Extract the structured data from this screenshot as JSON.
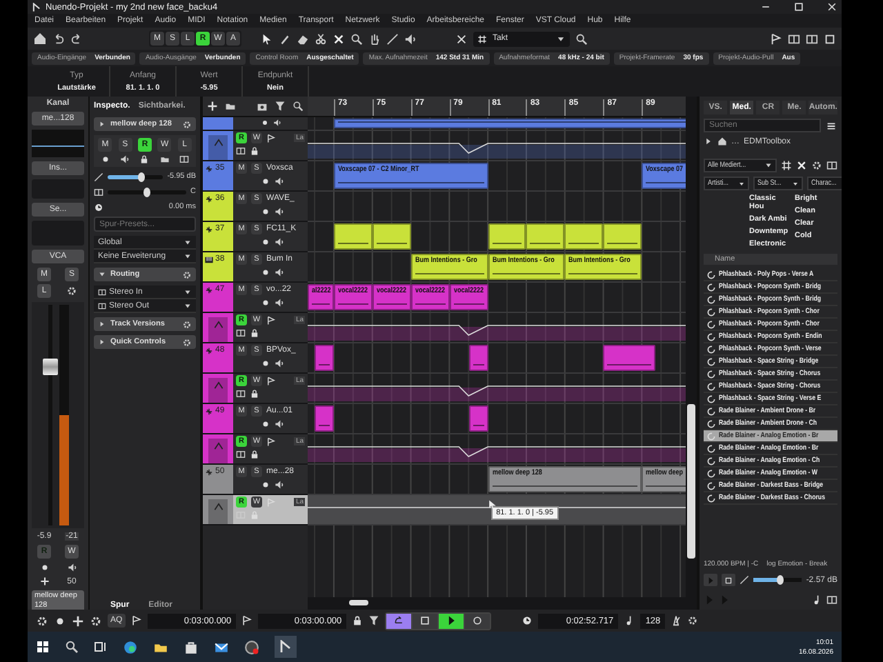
{
  "window": {
    "title": "Nuendo-Projekt - my 2nd new face_backu4"
  },
  "menu": [
    "Datei",
    "Bearbeiten",
    "Projekt",
    "Audio",
    "MIDI",
    "Notation",
    "Medien",
    "Transport",
    "Netzwerk",
    "Studio",
    "Arbeitsbereiche",
    "Fenster",
    "VST Cloud",
    "Hub",
    "Hilfe"
  ],
  "toolbar": {
    "modes": [
      {
        "label": "M",
        "on": false
      },
      {
        "label": "S",
        "on": false
      },
      {
        "label": "L",
        "on": false
      },
      {
        "label": "R",
        "on": true
      },
      {
        "label": "W",
        "on": false
      },
      {
        "label": "A",
        "on": false
      }
    ],
    "grid_type": "Takt"
  },
  "status_line": [
    {
      "label": "Audio-Eingänge",
      "value": "Verbunden"
    },
    {
      "label": "Audio-Ausgänge",
      "value": "Verbunden"
    },
    {
      "label": "Control Room",
      "value": "Ausgeschaltet"
    },
    {
      "label": "Max. Aufnahmezeit",
      "value": "142 Std 31 Min"
    },
    {
      "label": "Aufnahmeformat",
      "value": "48 kHz - 24 bit"
    },
    {
      "label": "Projekt-Framerate",
      "value": "30 fps"
    },
    {
      "label": "Projekt-Audio-Pull",
      "value": "Aus"
    }
  ],
  "info_line": [
    {
      "label": "Typ",
      "value": "Lautstärke"
    },
    {
      "label": "Anfang",
      "value": "81. 1. 1. 0"
    },
    {
      "label": "Wert",
      "value": "-5.95"
    },
    {
      "label": "Endpunkt",
      "value": "Nein"
    }
  ],
  "channel": {
    "title": "Kanal",
    "name_button": "me...128",
    "inserts": "Ins...",
    "sends": "Se...",
    "vca": "VCA",
    "buttons": [
      {
        "label": "M",
        "on": false
      },
      {
        "label": "S",
        "on": false
      },
      {
        "label": "L",
        "on": false
      }
    ],
    "fader": {
      "level": 0.72
    },
    "meter": {
      "level": 0.5
    },
    "reading": "-5.9",
    "peak": "-21",
    "read": {
      "label": "R",
      "on": true
    },
    "write": {
      "label": "W",
      "on": false
    },
    "pan": "50",
    "track_name": "mellow deep 128"
  },
  "inspector": {
    "tabs": [
      {
        "label": "Inspecto.",
        "selected": true
      },
      {
        "label": "Sichtbarkei.",
        "selected": false
      }
    ],
    "track_name": "mellow deep 128",
    "buttons": [
      {
        "label": "M",
        "on": false
      },
      {
        "label": "S",
        "on": false
      },
      {
        "label": "R",
        "on": true
      },
      {
        "label": "W",
        "on": false
      },
      {
        "label": "L",
        "on": false
      }
    ],
    "volume": {
      "level": 0.6,
      "reading": "-5.95 dB"
    },
    "pan": {
      "level": 0.5,
      "reading": "C"
    },
    "delay": {
      "reading": "0.00 ms"
    },
    "preset": {
      "placeholder": "Spur-Presets..."
    },
    "selects": [
      "Global",
      "Keine Erweiterung"
    ],
    "sections": [
      {
        "label": "Routing",
        "expanded": true,
        "items": [
          "Stereo In",
          "Stereo Out"
        ]
      },
      {
        "label": "Track Versions",
        "expanded": false
      },
      {
        "label": "Quick Controls",
        "expanded": false
      }
    ],
    "bottom_tabs": [
      {
        "label": "Spur",
        "selected": true
      },
      {
        "label": "Editor",
        "selected": false
      }
    ]
  },
  "ruler": [
    "73",
    "75",
    "77",
    "79",
    "81",
    "83",
    "85",
    "87",
    "89"
  ],
  "tracks": [
    {
      "kind": "tail",
      "color": "#5b7be0"
    },
    {
      "kind": "lane",
      "color": "#5b7be0",
      "param": "La",
      "buttons": [
        {
          "label": "R",
          "on": true
        },
        {
          "label": "W",
          "on": false
        }
      ],
      "selected": false
    },
    {
      "kind": "audio",
      "number": "35",
      "name": "Voxsca",
      "color": "#5b7be0",
      "buttons": [
        {
          "label": "M",
          "on": false
        },
        {
          "label": "S",
          "on": false
        }
      ],
      "clips": [
        "Voxscape 07 - C2 Minor_RT",
        "Voxscape 07"
      ]
    },
    {
      "kind": "audio",
      "number": "36",
      "name": "WAVE_",
      "color": "#c9e13a",
      "buttons": [
        {
          "label": "M",
          "on": false
        },
        {
          "label": "S",
          "on": false
        }
      ]
    },
    {
      "kind": "audio",
      "number": "37",
      "name": "FC11_K",
      "color": "#c9e13a",
      "buttons": [
        {
          "label": "M",
          "on": false
        },
        {
          "label": "S",
          "on": false
        }
      ]
    },
    {
      "kind": "instrument",
      "number": "38",
      "name": "Bum In",
      "color": "#c9e13a",
      "buttons": [
        {
          "label": "M",
          "on": false
        },
        {
          "label": "S",
          "on": false
        }
      ],
      "clips": [
        "Bum Intentions - Gro",
        "Bum Intentions - Gro",
        "Bum Intentions - Gro"
      ]
    },
    {
      "kind": "audio",
      "number": "47",
      "name": "vo...22",
      "color": "#d632c8",
      "buttons": [
        {
          "label": "M",
          "on": false
        },
        {
          "label": "S",
          "on": false
        }
      ],
      "clips": [
        "al2222",
        "vocal2222",
        "vocal2222",
        "vocal2222",
        "vocal2222"
      ]
    },
    {
      "kind": "lane",
      "color": "#d632c8",
      "param": "La",
      "buttons": [
        {
          "label": "R",
          "on": true
        },
        {
          "label": "W",
          "on": false
        }
      ],
      "selected": false
    },
    {
      "kind": "audio",
      "number": "48",
      "name": "BPVox_",
      "color": "#d632c8",
      "buttons": [
        {
          "label": "M",
          "on": false
        },
        {
          "label": "S",
          "on": false
        }
      ]
    },
    {
      "kind": "lane",
      "color": "#d632c8",
      "param": "La",
      "buttons": [
        {
          "label": "R",
          "on": true
        },
        {
          "label": "W",
          "on": false
        }
      ],
      "selected": false
    },
    {
      "kind": "audio",
      "number": "49",
      "name": "Au...01",
      "color": "#d632c8",
      "buttons": [
        {
          "label": "M",
          "on": false
        },
        {
          "label": "S",
          "on": false
        }
      ]
    },
    {
      "kind": "lane",
      "color": "#d632c8",
      "param": "La",
      "buttons": [
        {
          "label": "R",
          "on": true
        },
        {
          "label": "W",
          "on": false
        }
      ],
      "selected": false
    },
    {
      "kind": "audio",
      "number": "50",
      "name": "me...28",
      "color": "#8e8e90",
      "buttons": [
        {
          "label": "M",
          "on": false
        },
        {
          "label": "S",
          "on": false
        }
      ],
      "clips": [
        "mellow deep 128",
        "mellow deep"
      ]
    },
    {
      "kind": "lane",
      "color": "#8e8e90",
      "param": "La",
      "buttons": [
        {
          "label": "R",
          "on": true
        },
        {
          "label": "W",
          "on": false
        }
      ],
      "selected": true
    }
  ],
  "automation_tooltip": "81. 1. 1. 0 | -5.95",
  "media": {
    "tabs": [
      {
        "label": "VS.",
        "selected": false
      },
      {
        "label": "Med.",
        "selected": true
      },
      {
        "label": "CR",
        "selected": false
      },
      {
        "label": "Me.",
        "selected": false
      },
      {
        "label": "Autom.",
        "selected": false
      }
    ],
    "search": {
      "placeholder": "Suchen"
    },
    "path": [
      "…",
      "EDMToolbox"
    ],
    "filter": "Alle Mediert...",
    "columns": [
      "Artisti...",
      "Sub St...",
      "Charac..."
    ],
    "sub_styles": [
      "Classic Hou",
      "Dark Ambi",
      "Downtemp",
      "Electronic"
    ],
    "characters": [
      "Bright",
      "Clean",
      "Clear",
      "Cold"
    ],
    "name_header": "Name",
    "items": [
      {
        "name": "Phlashback - Poly Pops - Verse A",
        "selected": false
      },
      {
        "name": "Phlashback - Popcorn Synth - Bridg",
        "selected": false
      },
      {
        "name": "Phlashback - Popcorn Synth - Bridg",
        "selected": false
      },
      {
        "name": "Phlashback - Popcorn Synth - Chor",
        "selected": false
      },
      {
        "name": "Phlashback - Popcorn Synth - Chor",
        "selected": false
      },
      {
        "name": "Phlashback - Popcorn Synth - Endin",
        "selected": false
      },
      {
        "name": "Phlashback - Popcorn Synth - Verse",
        "selected": false
      },
      {
        "name": "Phlashback - Space String - Bridge",
        "selected": false
      },
      {
        "name": "Phlashback - Space String - Chorus",
        "selected": false
      },
      {
        "name": "Phlashback - Space String - Chorus",
        "selected": false
      },
      {
        "name": "Phlashback - Space String - Verse E",
        "selected": false
      },
      {
        "name": "Rade Blainer - Ambient Drone - Br",
        "selected": false
      },
      {
        "name": "Rade Blainer - Ambient Drone - Ch",
        "selected": false
      },
      {
        "name": "Rade Blainer - Analog Emotion - Br",
        "selected": true
      },
      {
        "name": "Rade Blainer - Analog Emotion - Br",
        "selected": false
      },
      {
        "name": "Rade Blainer - Analog Emotion - Ch",
        "selected": false
      },
      {
        "name": "Rade Blainer - Analog Emotion - W",
        "selected": false
      },
      {
        "name": "Rade Blainer - Darkest Bass - Bridge",
        "selected": false
      },
      {
        "name": "Rade Blainer - Darkest Bass - Chorus",
        "selected": false
      }
    ],
    "info": "120.000 BPM | -C",
    "file": "log Emotion - Break",
    "volume": {
      "level": 0.55,
      "reading": "-2.57 dB"
    }
  },
  "transport": {
    "aq": "AQ",
    "left_locator": "0:03:00.000",
    "right_locator": "0:03:00.000",
    "buttons": [
      {
        "kind": "cycle",
        "on": true
      },
      {
        "kind": "stop",
        "on": false
      },
      {
        "kind": "play",
        "on": true
      },
      {
        "kind": "record",
        "on": false
      }
    ],
    "time": "0:02:52.717",
    "tempo": "128"
  },
  "taskbar": {
    "time": "10:01",
    "date": "16.08.2026"
  }
}
